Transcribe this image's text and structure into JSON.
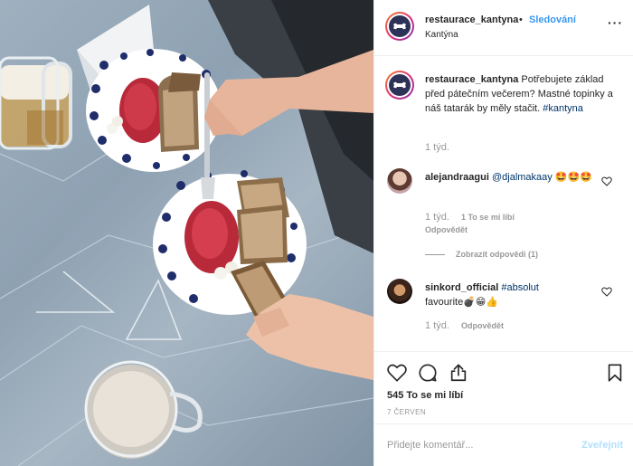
{
  "header": {
    "username": "restaurace_kantyna",
    "separator": "•",
    "follow_label": "Sledování",
    "location": "Kantýna",
    "more_label": "···"
  },
  "caption": {
    "username": "restaurace_kantyna",
    "text": "Potřebujete základ před pátečním večerem? Mastné topinky a náš tatarák by měly stačit.",
    "hashtag": "#kantyna",
    "time": "1 týd."
  },
  "comments": [
    {
      "username": "alejandraagui",
      "mention": "@djalmakaay",
      "emoji": "🤩🤩🤩",
      "time": "1 týd.",
      "likes": "1 To se mi líbí",
      "reply_label": "Odpovědět",
      "view_replies": "Zobrazit odpovědi (1)"
    },
    {
      "username": "sinkord_official",
      "hashtag": "#absolut",
      "text": "favourite💣😁👍",
      "time": "1 týd.",
      "reply_label": "Odpovědět"
    }
  ],
  "actions": {
    "likes": "545 To se mi líbí",
    "date": "7 červen"
  },
  "add_comment": {
    "placeholder": "Přidejte komentář...",
    "post_label": "Zveřejnit"
  },
  "colors": {
    "accent": "#3897f0",
    "hashtag": "#003569",
    "muted": "#999999",
    "post_disabled": "#b2dffc",
    "avatar_bg": "#2d3258"
  },
  "photo": {
    "description_icon": "food-photo"
  }
}
